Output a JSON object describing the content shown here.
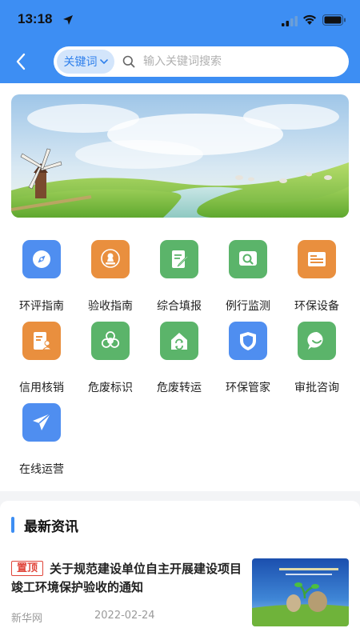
{
  "status_bar": {
    "time": "13:18"
  },
  "header": {
    "keyword_label": "关键词",
    "search_placeholder": "输入关键词搜索"
  },
  "grid": {
    "items": [
      {
        "label": "环评指南",
        "color": "#4f8ef0",
        "icon": "compass-icon"
      },
      {
        "label": "验收指南",
        "color": "#e98f3e",
        "icon": "stamp-icon"
      },
      {
        "label": "综合填报",
        "color": "#5bb46a",
        "icon": "edit-form-icon"
      },
      {
        "label": "例行监测",
        "color": "#5bb46a",
        "icon": "monitor-search-icon"
      },
      {
        "label": "环保设备",
        "color": "#e98f3e",
        "icon": "equipment-icon"
      },
      {
        "label": "信用核销",
        "color": "#e98f3e",
        "icon": "credit-doc-icon"
      },
      {
        "label": "危废标识",
        "color": "#5bb46a",
        "icon": "biohazard-icon"
      },
      {
        "label": "危废转运",
        "color": "#5bb46a",
        "icon": "transfer-house-icon"
      },
      {
        "label": "环保管家",
        "color": "#4f8ef0",
        "icon": "shield-icon"
      },
      {
        "label": "审批咨询",
        "color": "#5bb46a",
        "icon": "chat-icon"
      },
      {
        "label": "在线运营",
        "color": "#4f8ef0",
        "icon": "paper-plane-icon"
      }
    ]
  },
  "news": {
    "section_title": "最新资讯",
    "items": [
      {
        "badge": "置顶",
        "headline": "关于规范建设单位自主开展建设项目竣工环境保护验收的通知",
        "source": "新华网",
        "date": "2022-02-24"
      }
    ]
  }
}
